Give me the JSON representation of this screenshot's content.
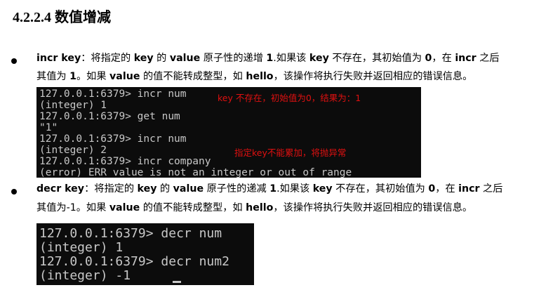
{
  "heading": {
    "number": "4.2.2.4",
    "title": "数值增减"
  },
  "incr": {
    "line1": [
      {
        "t": "incr key",
        "b": true
      },
      {
        "t": "：将指定的 ",
        "b": false
      },
      {
        "t": "key",
        "b": true
      },
      {
        "t": " 的 ",
        "b": false
      },
      {
        "t": "value",
        "b": true
      },
      {
        "t": " 原子性的递增 ",
        "b": false
      },
      {
        "t": "1",
        "b": true
      },
      {
        "t": ".如果该 ",
        "b": false
      },
      {
        "t": "key",
        "b": true
      },
      {
        "t": " 不存在，其初始值为 ",
        "b": false
      },
      {
        "t": "0",
        "b": true
      },
      {
        "t": "，在 ",
        "b": false
      },
      {
        "t": "incr",
        "b": true
      },
      {
        "t": " 之后",
        "b": false
      }
    ],
    "line2": [
      {
        "t": "其值为 ",
        "b": false
      },
      {
        "t": "1",
        "b": true
      },
      {
        "t": "。如果 ",
        "b": false
      },
      {
        "t": "value",
        "b": true
      },
      {
        "t": " 的值不能转成整型，如 ",
        "b": false
      },
      {
        "t": "hello",
        "b": true
      },
      {
        "t": "，该操作将执行失败并返回相应的错误信息。",
        "b": false
      }
    ],
    "terminal": [
      "127.0.0.1:6379> incr num",
      "(integer) 1",
      "127.0.0.1:6379> get num",
      "\"1\"",
      "127.0.0.1:6379> incr num",
      "(integer) 2",
      "127.0.0.1:6379> incr company",
      "(error) ERR value is not an integer or out of range"
    ],
    "note1": "key 不存在，初始值为0，结果为：1",
    "note2": "指定key不能累加，将抛异常"
  },
  "decr": {
    "line1": [
      {
        "t": "decr key",
        "b": true
      },
      {
        "t": "：将指定的 ",
        "b": false
      },
      {
        "t": "key",
        "b": true
      },
      {
        "t": " 的 ",
        "b": false
      },
      {
        "t": "value",
        "b": true
      },
      {
        "t": " 原子性的递减 ",
        "b": false
      },
      {
        "t": "1",
        "b": true
      },
      {
        "t": ".如果该 ",
        "b": false
      },
      {
        "t": "key",
        "b": true
      },
      {
        "t": " 不存在，其初始值为 ",
        "b": false
      },
      {
        "t": "0",
        "b": true
      },
      {
        "t": "，在 ",
        "b": false
      },
      {
        "t": "incr",
        "b": true
      },
      {
        "t": " 之后",
        "b": false
      }
    ],
    "line2": [
      {
        "t": "其值为",
        "b": false
      },
      {
        "t": "-1",
        "b": false
      },
      {
        "t": "。如果 ",
        "b": false
      },
      {
        "t": "value",
        "b": true
      },
      {
        "t": " 的值不能转成整型，如 ",
        "b": false
      },
      {
        "t": "hello",
        "b": true
      },
      {
        "t": "，该操作将执行失败并返回相应的错误信息。",
        "b": false
      }
    ],
    "terminal": [
      "127.0.0.1:6379> decr num",
      "(integer) 1",
      "127.0.0.1:6379> decr num2",
      "(integer) -1"
    ]
  },
  "colors": {
    "terminal_bg": "#0c0c0c",
    "terminal_fg": "#c8c8c8",
    "annotation": "#e01010"
  }
}
